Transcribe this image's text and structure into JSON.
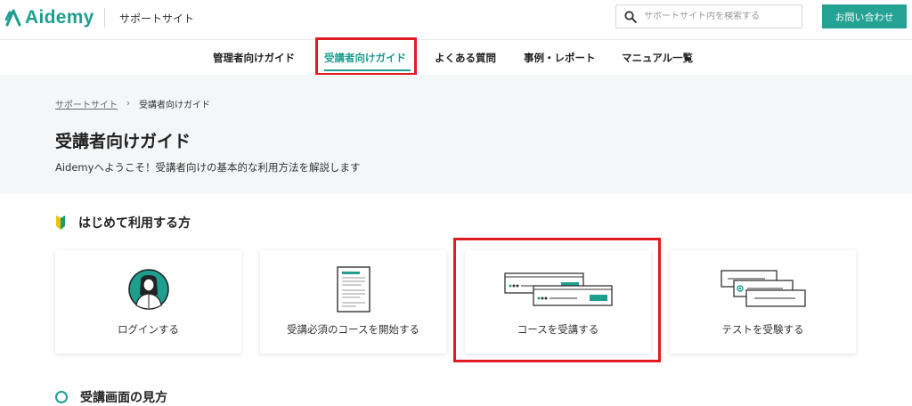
{
  "header": {
    "logo_text": "Aidemy",
    "site_name": "サポートサイト",
    "search_placeholder": "サポートサイト内を検索する",
    "contact_label": "お問い合わせ"
  },
  "nav": {
    "items": [
      {
        "label": "管理者向けガイド"
      },
      {
        "label": "受講者向けガイド"
      },
      {
        "label": "よくある質問"
      },
      {
        "label": "事例・レポート"
      },
      {
        "label": "マニュアル一覧"
      }
    ]
  },
  "breadcrumb": {
    "home": "サポートサイト",
    "separator": "›",
    "current": "受講者向けガイド"
  },
  "hero": {
    "title": "受講者向けガイド",
    "description": "Aidemyへようこそ！受講者向けの基本的な利用方法を解説します"
  },
  "section": {
    "title": "はじめて利用する方",
    "cards": [
      {
        "label": "ログインする",
        "icon": "login-person-icon"
      },
      {
        "label": "受講必須のコースを開始する",
        "icon": "document-icon"
      },
      {
        "label": "コースを受講する",
        "icon": "course-windows-icon"
      },
      {
        "label": "テストを受験する",
        "icon": "test-windows-icon"
      }
    ]
  },
  "next_section": {
    "title": "受講画面の見方"
  },
  "colors": {
    "brand": "#1d9e8e",
    "highlight": "#e01b24",
    "hero_bg": "#f5f6f7"
  }
}
